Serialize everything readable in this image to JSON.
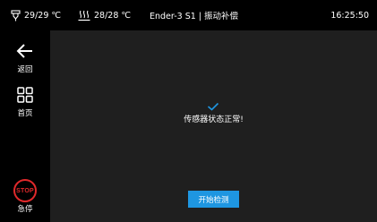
{
  "status_bar": {
    "nozzle_temp": "29/29 ℃",
    "bed_temp": "28/28 ℃",
    "title": "Ender-3 S1 | 振动补偿",
    "time": "16:25:50",
    "nozzle_icon": "nozzle-icon",
    "bed_icon": "heated-bed-icon"
  },
  "sidebar": {
    "back_label": "返回",
    "home_label": "首页",
    "stop_badge": "STOP",
    "stop_label": "急停"
  },
  "main": {
    "check_icon": "checkmark-icon",
    "message": "传感器状态正常!",
    "start_button_label": "开始检测"
  },
  "colors": {
    "accent": "#1e96e1",
    "stop": "#e0292b",
    "panel": "#1f1f1f",
    "background": "#000000",
    "check": "#1e96e1"
  }
}
